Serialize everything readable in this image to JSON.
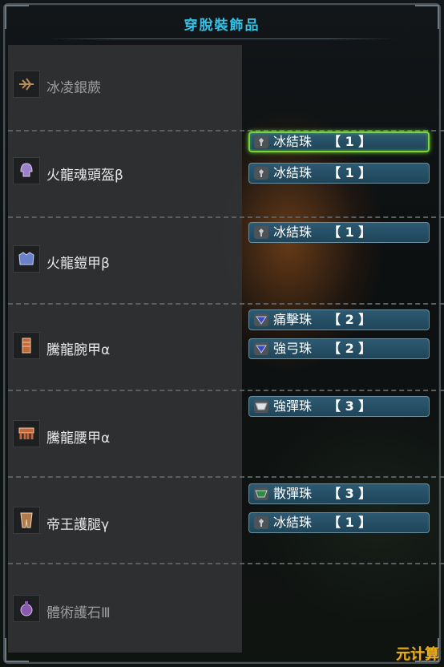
{
  "title": "穿脫裝飾品",
  "armor": [
    {
      "name": "冰凌銀蕨",
      "icon": "charm-weapon-icon",
      "dim": true,
      "decorations": []
    },
    {
      "name": "火龍魂頭盔β",
      "icon": "helmet-icon",
      "dim": false,
      "decorations": [
        {
          "name": "冰結珠",
          "level": "【 1 】",
          "selected": true,
          "jewel": "jewel-lv1-icon"
        },
        {
          "name": "冰結珠",
          "level": "【 1 】",
          "selected": false,
          "jewel": "jewel-lv1-icon"
        }
      ]
    },
    {
      "name": "火龍鎧甲β",
      "icon": "chest-armor-icon",
      "dim": false,
      "decorations": [
        {
          "name": "冰結珠",
          "level": "【 1 】",
          "selected": false,
          "jewel": "jewel-lv1-icon"
        }
      ]
    },
    {
      "name": "騰龍腕甲α",
      "icon": "gauntlet-icon",
      "dim": false,
      "decorations": [
        {
          "name": "痛擊珠",
          "level": "【 2 】",
          "selected": false,
          "jewel": "jewel-lv2-icon"
        },
        {
          "name": "強弓珠",
          "level": "【 2 】",
          "selected": false,
          "jewel": "jewel-lv2-icon"
        }
      ]
    },
    {
      "name": "騰龍腰甲α",
      "icon": "waist-armor-icon",
      "dim": false,
      "decorations": [
        {
          "name": "強彈珠",
          "level": "【 3 】",
          "selected": false,
          "jewel": "jewel-lv3-icon"
        }
      ]
    },
    {
      "name": "帝王護腿γ",
      "icon": "leg-armor-icon",
      "dim": false,
      "decorations": [
        {
          "name": "散彈珠",
          "level": "【 3 】",
          "selected": false,
          "jewel": "jewel-lv3-icon"
        },
        {
          "name": "冰結珠",
          "level": "【 1 】",
          "selected": false,
          "jewel": "jewel-lv1-icon"
        }
      ]
    },
    {
      "name": "體術護石Ⅲ",
      "icon": "charm-icon",
      "dim": true,
      "decorations": []
    }
  ],
  "watermark": "元计算",
  "colors": {
    "title": "#33c1e6",
    "selected_border": "#7ad43c",
    "deco_bg": "#2d5a72"
  }
}
